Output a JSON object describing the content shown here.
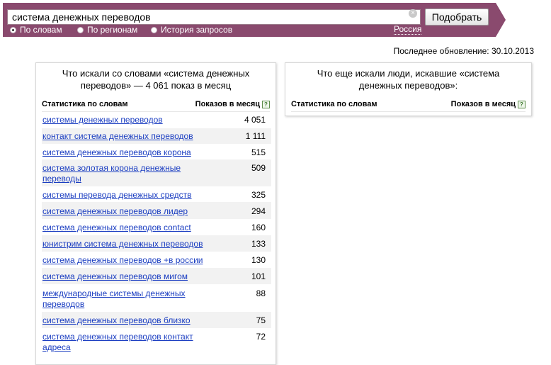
{
  "search": {
    "query": "система денежных переводов",
    "submit_label": "Подобрать",
    "clear_glyph": "×"
  },
  "filters": [
    {
      "label": "По словам",
      "checked": true
    },
    {
      "label": "По регионам",
      "checked": false
    },
    {
      "label": "История запросов",
      "checked": false
    }
  ],
  "region": "Россия",
  "last_update": "Последнее обновление: 30.10.2013",
  "left_panel": {
    "title": "Что искали со словами «система денежных переводов» — 4 061 показ в месяц",
    "col_words": "Статистика по словам",
    "col_count": "Показов в месяц",
    "rows": [
      {
        "phrase": "системы денежных переводов",
        "count": "4 051"
      },
      {
        "phrase": "контакт система денежных переводов",
        "count": "1 111"
      },
      {
        "phrase": "система денежных переводов корона",
        "count": "515"
      },
      {
        "phrase": "система золотая корона денежные переводы",
        "count": "509"
      },
      {
        "phrase": "системы перевода денежных средств",
        "count": "325"
      },
      {
        "phrase": "система денежных переводов лидер",
        "count": "294"
      },
      {
        "phrase": "система денежных переводов contact",
        "count": "160"
      },
      {
        "phrase": "юнистрим система денежных переводов",
        "count": "133"
      },
      {
        "phrase": "система денежных переводов +в россии",
        "count": "130"
      },
      {
        "phrase": "система денежных переводов мигом",
        "count": "101"
      },
      {
        "phrase": "международные системы денежных переводов",
        "count": "88"
      },
      {
        "phrase": "система денежных переводов близко",
        "count": "75"
      },
      {
        "phrase": "система денежных переводов контакт адреса",
        "count": "72"
      }
    ]
  },
  "right_panel": {
    "title": "Что еще искали люди, искавшие «система денежных переводов»:",
    "col_words": "Статистика по словам",
    "col_count": "Показов в месяц"
  },
  "help_glyph": "?",
  "colors": {
    "banner": "#8a4a6e",
    "link": "#1a3dc1",
    "alt_row": "#f2f2f2"
  }
}
